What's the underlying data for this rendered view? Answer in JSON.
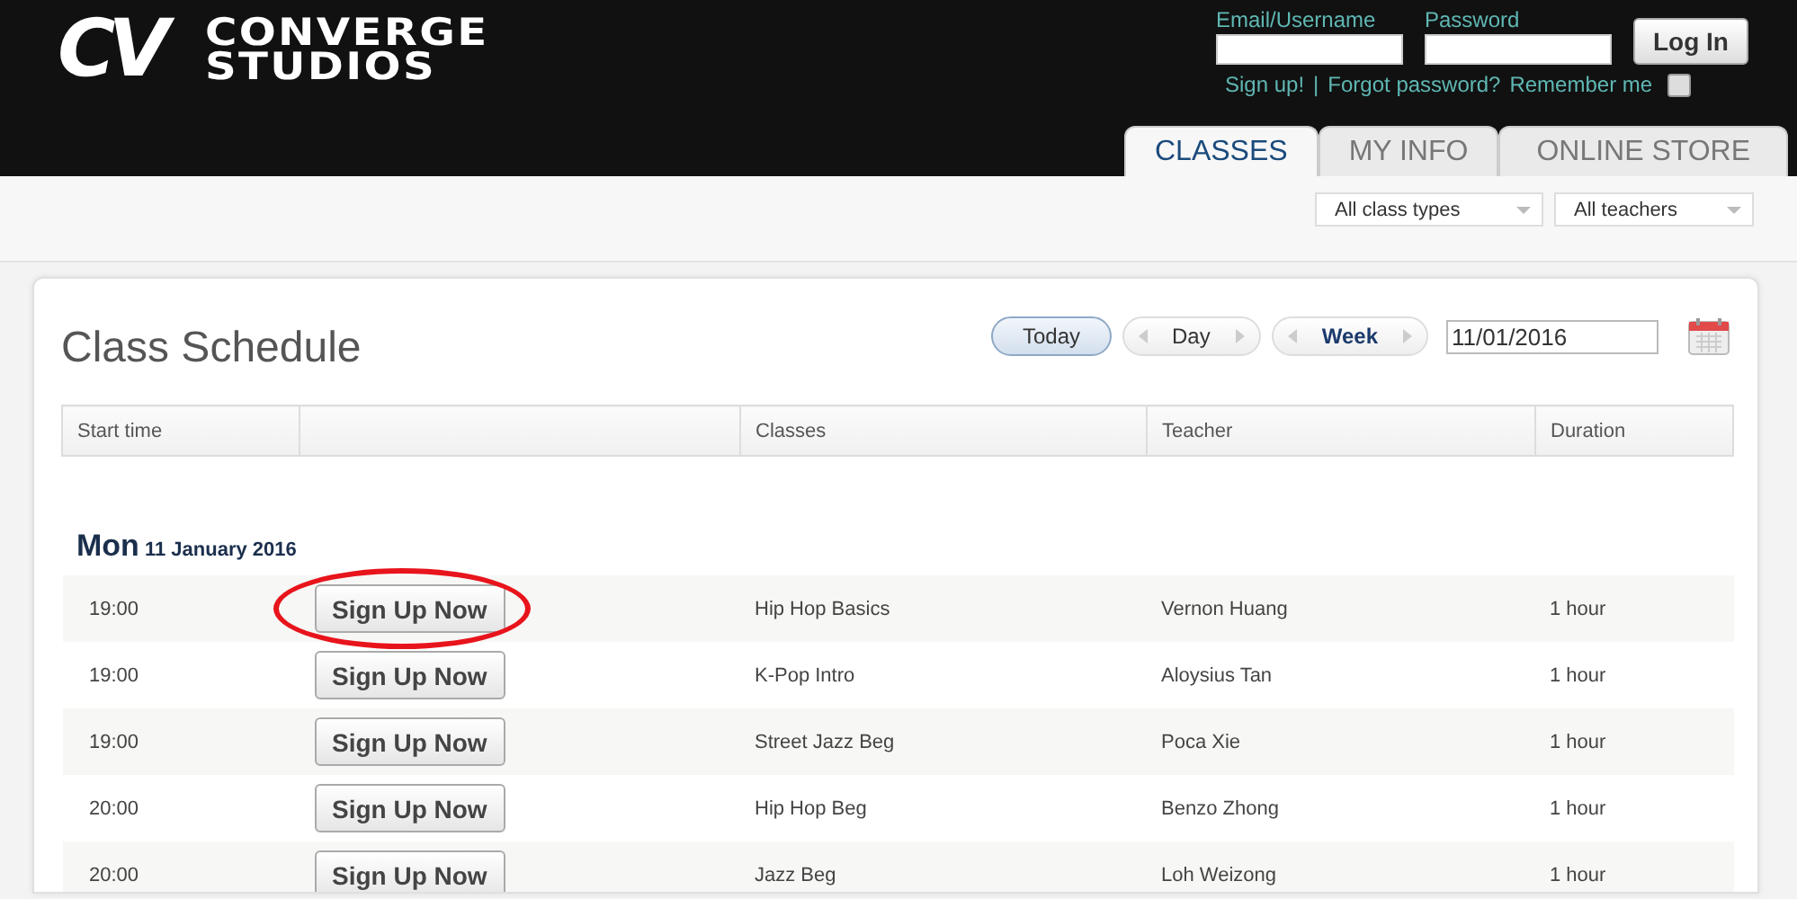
{
  "logo": {
    "mark": "CV",
    "line1": "CONVERGE",
    "line2": "STUDIOS"
  },
  "login": {
    "email_label": "Email/Username",
    "password_label": "Password",
    "button": "Log In",
    "signup_link": "Sign up!",
    "separator": "|",
    "forgot_link": "Forgot password?",
    "remember_label": "Remember me",
    "remember_checked": false
  },
  "tabs": [
    {
      "label": "CLASSES",
      "selected": true
    },
    {
      "label": "MY INFO",
      "selected": false
    },
    {
      "label": "ONLINE STORE",
      "selected": false
    }
  ],
  "filters": [
    {
      "value": "All class types"
    },
    {
      "value": "All teachers"
    }
  ],
  "schedule": {
    "title": "Class Schedule",
    "today_button": "Today",
    "views": [
      {
        "label": "Day",
        "selected": false
      },
      {
        "label": "Week",
        "selected": true
      }
    ],
    "date": "11/01/2016",
    "columns": [
      "Start time",
      "",
      "Classes",
      "Teacher",
      "Duration"
    ],
    "day": {
      "weekday": "Mon",
      "date": "11 January 2016"
    },
    "rows": [
      {
        "time": "19:00",
        "button": "Sign Up Now",
        "class": "Hip Hop Basics",
        "teacher": "Vernon Huang",
        "duration": "1 hour",
        "circled": true
      },
      {
        "time": "19:00",
        "button": "Sign Up Now",
        "class": "K-Pop Intro",
        "teacher": "Aloysius Tan",
        "duration": "1 hour",
        "circled": false
      },
      {
        "time": "19:00",
        "button": "Sign Up Now",
        "class": "Street Jazz Beg",
        "teacher": "Poca Xie",
        "duration": "1 hour",
        "circled": false
      },
      {
        "time": "20:00",
        "button": "Sign Up Now",
        "class": "Hip Hop Beg",
        "teacher": "Benzo Zhong",
        "duration": "1 hour",
        "circled": false
      },
      {
        "time": "20:00",
        "button": "Sign Up Now",
        "class": "Jazz Beg",
        "teacher": "Loh Weizong",
        "duration": "1 hour",
        "circled": false
      }
    ]
  }
}
